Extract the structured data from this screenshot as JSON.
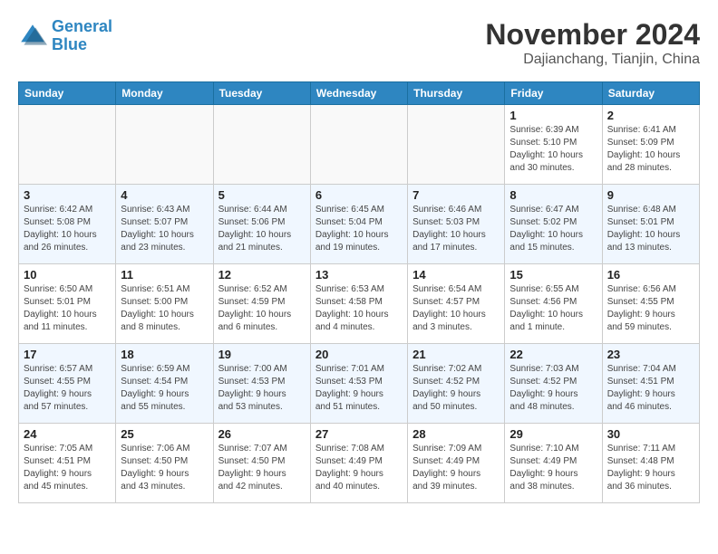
{
  "header": {
    "logo_line1": "General",
    "logo_line2": "Blue",
    "month_title": "November 2024",
    "location": "Dajianchang, Tianjin, China"
  },
  "weekdays": [
    "Sunday",
    "Monday",
    "Tuesday",
    "Wednesday",
    "Thursday",
    "Friday",
    "Saturday"
  ],
  "weeks": [
    [
      {
        "day": "",
        "info": ""
      },
      {
        "day": "",
        "info": ""
      },
      {
        "day": "",
        "info": ""
      },
      {
        "day": "",
        "info": ""
      },
      {
        "day": "",
        "info": ""
      },
      {
        "day": "1",
        "info": "Sunrise: 6:39 AM\nSunset: 5:10 PM\nDaylight: 10 hours\nand 30 minutes."
      },
      {
        "day": "2",
        "info": "Sunrise: 6:41 AM\nSunset: 5:09 PM\nDaylight: 10 hours\nand 28 minutes."
      }
    ],
    [
      {
        "day": "3",
        "info": "Sunrise: 6:42 AM\nSunset: 5:08 PM\nDaylight: 10 hours\nand 26 minutes."
      },
      {
        "day": "4",
        "info": "Sunrise: 6:43 AM\nSunset: 5:07 PM\nDaylight: 10 hours\nand 23 minutes."
      },
      {
        "day": "5",
        "info": "Sunrise: 6:44 AM\nSunset: 5:06 PM\nDaylight: 10 hours\nand 21 minutes."
      },
      {
        "day": "6",
        "info": "Sunrise: 6:45 AM\nSunset: 5:04 PM\nDaylight: 10 hours\nand 19 minutes."
      },
      {
        "day": "7",
        "info": "Sunrise: 6:46 AM\nSunset: 5:03 PM\nDaylight: 10 hours\nand 17 minutes."
      },
      {
        "day": "8",
        "info": "Sunrise: 6:47 AM\nSunset: 5:02 PM\nDaylight: 10 hours\nand 15 minutes."
      },
      {
        "day": "9",
        "info": "Sunrise: 6:48 AM\nSunset: 5:01 PM\nDaylight: 10 hours\nand 13 minutes."
      }
    ],
    [
      {
        "day": "10",
        "info": "Sunrise: 6:50 AM\nSunset: 5:01 PM\nDaylight: 10 hours\nand 11 minutes."
      },
      {
        "day": "11",
        "info": "Sunrise: 6:51 AM\nSunset: 5:00 PM\nDaylight: 10 hours\nand 8 minutes."
      },
      {
        "day": "12",
        "info": "Sunrise: 6:52 AM\nSunset: 4:59 PM\nDaylight: 10 hours\nand 6 minutes."
      },
      {
        "day": "13",
        "info": "Sunrise: 6:53 AM\nSunset: 4:58 PM\nDaylight: 10 hours\nand 4 minutes."
      },
      {
        "day": "14",
        "info": "Sunrise: 6:54 AM\nSunset: 4:57 PM\nDaylight: 10 hours\nand 3 minutes."
      },
      {
        "day": "15",
        "info": "Sunrise: 6:55 AM\nSunset: 4:56 PM\nDaylight: 10 hours\nand 1 minute."
      },
      {
        "day": "16",
        "info": "Sunrise: 6:56 AM\nSunset: 4:55 PM\nDaylight: 9 hours\nand 59 minutes."
      }
    ],
    [
      {
        "day": "17",
        "info": "Sunrise: 6:57 AM\nSunset: 4:55 PM\nDaylight: 9 hours\nand 57 minutes."
      },
      {
        "day": "18",
        "info": "Sunrise: 6:59 AM\nSunset: 4:54 PM\nDaylight: 9 hours\nand 55 minutes."
      },
      {
        "day": "19",
        "info": "Sunrise: 7:00 AM\nSunset: 4:53 PM\nDaylight: 9 hours\nand 53 minutes."
      },
      {
        "day": "20",
        "info": "Sunrise: 7:01 AM\nSunset: 4:53 PM\nDaylight: 9 hours\nand 51 minutes."
      },
      {
        "day": "21",
        "info": "Sunrise: 7:02 AM\nSunset: 4:52 PM\nDaylight: 9 hours\nand 50 minutes."
      },
      {
        "day": "22",
        "info": "Sunrise: 7:03 AM\nSunset: 4:52 PM\nDaylight: 9 hours\nand 48 minutes."
      },
      {
        "day": "23",
        "info": "Sunrise: 7:04 AM\nSunset: 4:51 PM\nDaylight: 9 hours\nand 46 minutes."
      }
    ],
    [
      {
        "day": "24",
        "info": "Sunrise: 7:05 AM\nSunset: 4:51 PM\nDaylight: 9 hours\nand 45 minutes."
      },
      {
        "day": "25",
        "info": "Sunrise: 7:06 AM\nSunset: 4:50 PM\nDaylight: 9 hours\nand 43 minutes."
      },
      {
        "day": "26",
        "info": "Sunrise: 7:07 AM\nSunset: 4:50 PM\nDaylight: 9 hours\nand 42 minutes."
      },
      {
        "day": "27",
        "info": "Sunrise: 7:08 AM\nSunset: 4:49 PM\nDaylight: 9 hours\nand 40 minutes."
      },
      {
        "day": "28",
        "info": "Sunrise: 7:09 AM\nSunset: 4:49 PM\nDaylight: 9 hours\nand 39 minutes."
      },
      {
        "day": "29",
        "info": "Sunrise: 7:10 AM\nSunset: 4:49 PM\nDaylight: 9 hours\nand 38 minutes."
      },
      {
        "day": "30",
        "info": "Sunrise: 7:11 AM\nSunset: 4:48 PM\nDaylight: 9 hours\nand 36 minutes."
      }
    ]
  ]
}
